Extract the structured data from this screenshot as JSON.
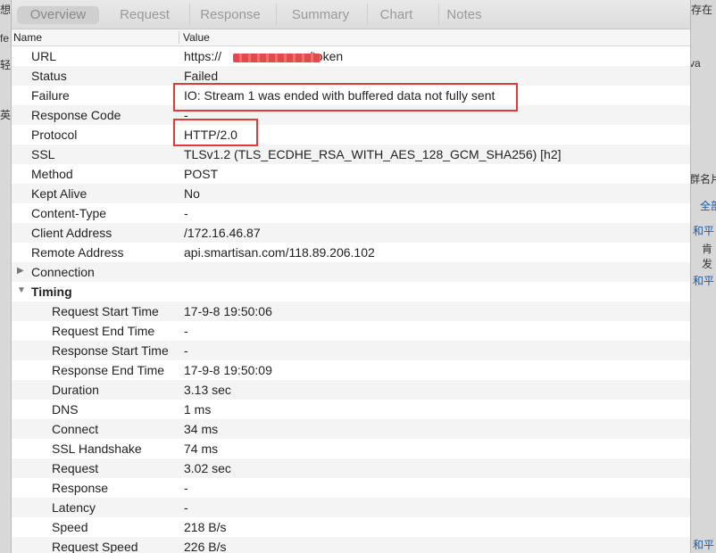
{
  "tabs": [
    "Overview",
    "Request",
    "Response",
    "Summary",
    "Chart",
    "Notes"
  ],
  "columns": {
    "name": "Name",
    "value": "Value"
  },
  "rows": [
    {
      "name": "URL",
      "value": "https://",
      "suffix": "/token"
    },
    {
      "name": "Status",
      "value": "Failed"
    },
    {
      "name": "Failure",
      "value": "IO: Stream 1 was ended with buffered data not fully sent"
    },
    {
      "name": "Response Code",
      "value": "-"
    },
    {
      "name": "Protocol",
      "value": "HTTP/2.0"
    },
    {
      "name": "SSL",
      "value": "TLSv1.2 (TLS_ECDHE_RSA_WITH_AES_128_GCM_SHA256) [h2]"
    },
    {
      "name": "Method",
      "value": "POST"
    },
    {
      "name": "Kept Alive",
      "value": "No"
    },
    {
      "name": "Content-Type",
      "value": "-"
    },
    {
      "name": "Client Address",
      "value": "/172.16.46.87"
    },
    {
      "name": "Remote Address",
      "value": "api.smartisan.com/118.89.206.102"
    },
    {
      "name": "Connection",
      "value": ""
    },
    {
      "name": "Timing",
      "value": ""
    },
    {
      "name": "Request Start Time",
      "value": "17-9-8 19:50:06"
    },
    {
      "name": "Request End Time",
      "value": "-"
    },
    {
      "name": "Response Start Time",
      "value": "-"
    },
    {
      "name": "Response End Time",
      "value": "17-9-8 19:50:09"
    },
    {
      "name": "Duration",
      "value": "3.13 sec"
    },
    {
      "name": "DNS",
      "value": "1 ms"
    },
    {
      "name": "Connect",
      "value": "34 ms"
    },
    {
      "name": "SSL Handshake",
      "value": "74 ms"
    },
    {
      "name": "Request",
      "value": "3.02 sec"
    },
    {
      "name": "Response",
      "value": "-"
    },
    {
      "name": "Latency",
      "value": "-"
    },
    {
      "name": "Speed",
      "value": "218 B/s"
    },
    {
      "name": "Request Speed",
      "value": "226 B/s"
    }
  ],
  "background": {
    "left": [
      "想",
      "fe",
      "轻",
      "英"
    ],
    "right": [
      "存在",
      "va",
      "群名片",
      "全部",
      "和平",
      "肯",
      "发",
      "和平",
      "和平"
    ]
  },
  "colors": {
    "highlight": "#e03a3a",
    "active_tab": "#cfcfcf"
  }
}
